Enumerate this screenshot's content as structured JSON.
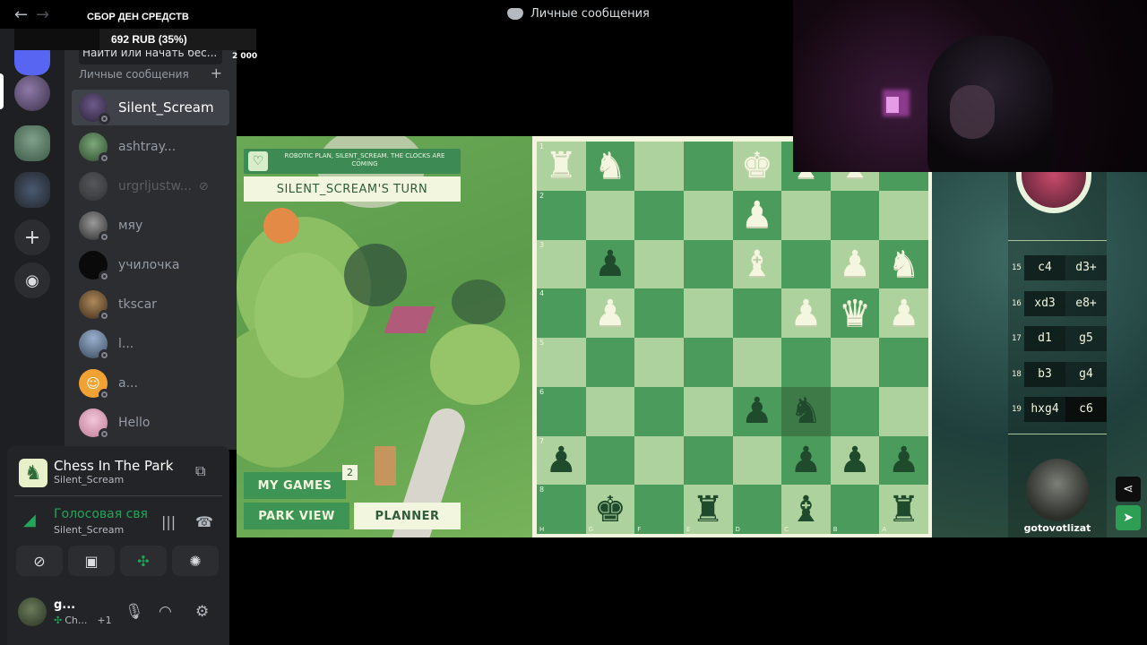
{
  "titlebar": {
    "title": "Личные сообщения"
  },
  "donation": {
    "title": "СБОР ДЕН СРЕДСТВ",
    "progress_text": "692 RUB (35%)",
    "goal": "2 000",
    "progress": 0.35
  },
  "sidebar": {
    "search_text": "Найти или начать бес...",
    "dm_header": "Личные сообщения",
    "add_symbol": "+",
    "dms": [
      {
        "name": "Silent_Scream"
      },
      {
        "name": "ashtray..."
      },
      {
        "name": "urgrljustw..."
      },
      {
        "name": "мяу"
      },
      {
        "name": "училочка"
      },
      {
        "name": "tkscar"
      },
      {
        "name": "l..."
      },
      {
        "name": "a..."
      },
      {
        "name": "Hello"
      }
    ]
  },
  "activity": {
    "title": "Chess In The Park",
    "subtitle": "Silent_Scream"
  },
  "voice": {
    "title": "Голосовая связь",
    "subtitle": "Silent_Scream"
  },
  "user": {
    "name": "g...",
    "status": "Ch...",
    "extra": "+1"
  },
  "game": {
    "plan_banner": "ROBOTIC PLAN, SILENT_SCREAM. THE CLOCKS ARE COMING",
    "turn": "SILENT_SCREAM'S TURN",
    "my_games": "MY GAMES",
    "my_games_count": "2",
    "park_view": "PARK VIEW",
    "planner": "PLANNER"
  },
  "board": {
    "ranks": [
      "1",
      "2",
      "3",
      "4",
      "5",
      "6",
      "7",
      "8"
    ],
    "files": [
      "H",
      "G",
      "F",
      "E",
      "D",
      "C",
      "B",
      "A"
    ],
    "squares": [
      [
        "wr",
        "wn",
        "",
        "",
        "wk",
        "wb",
        "wb",
        ""
      ],
      [
        "",
        "",
        "",
        "",
        "wp",
        "",
        "",
        ""
      ],
      [
        "",
        "bp",
        "",
        "",
        "wb",
        "",
        "wp",
        "wn"
      ],
      [
        "",
        "wp",
        "",
        "",
        "",
        "wp",
        "wq",
        "wp"
      ],
      [
        "",
        "",
        "",
        "",
        "",
        "",
        "",
        ""
      ],
      [
        "",
        "",
        "",
        "",
        "bp",
        "bn",
        "",
        ""
      ],
      [
        "bp",
        "",
        "",
        "",
        "",
        "bp",
        "bp",
        "bp"
      ],
      [
        "",
        "bk",
        "",
        "br",
        "",
        "bb",
        "",
        "br"
      ]
    ]
  },
  "moves": [
    {
      "num": "15",
      "white": "c4",
      "black": "d3+"
    },
    {
      "num": "16",
      "white": "xd3",
      "black": "e8+"
    },
    {
      "num": "17",
      "white": "d1",
      "black": "g5"
    },
    {
      "num": "18",
      "white": "b3",
      "black": "g4"
    },
    {
      "num": "19",
      "white": "hxg4",
      "black": "c6"
    }
  ],
  "player": {
    "name": "gotovotlizat"
  }
}
